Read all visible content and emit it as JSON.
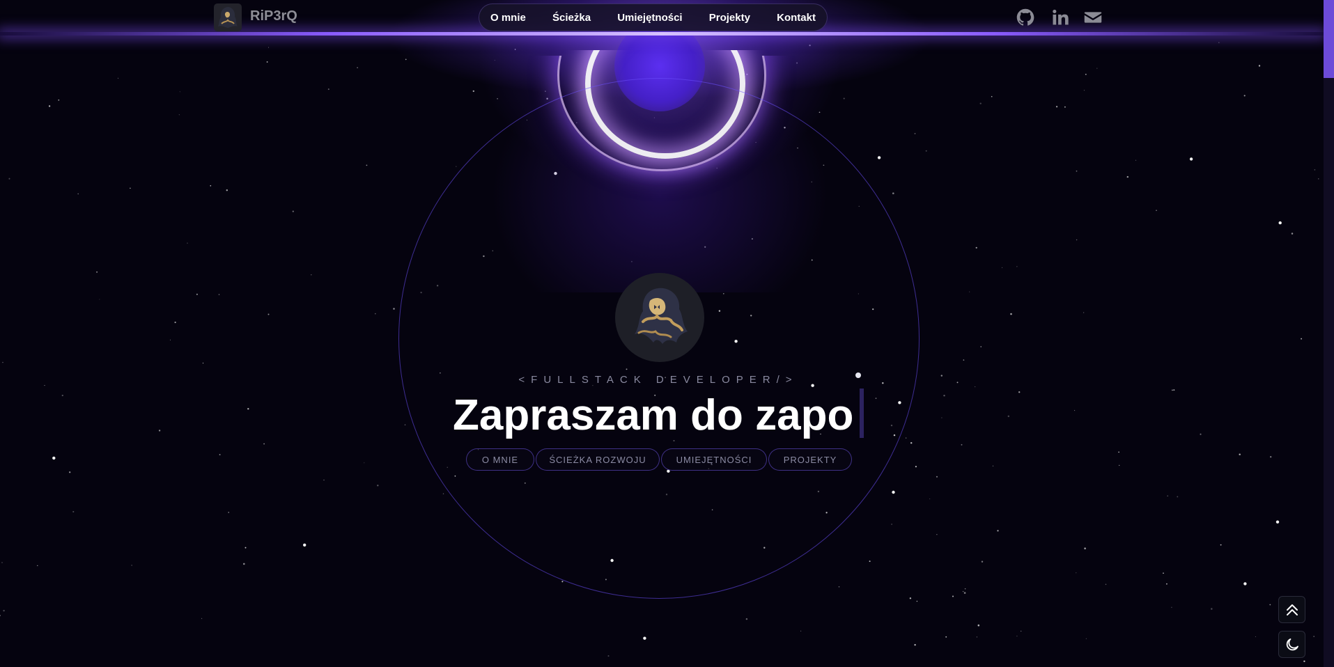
{
  "header": {
    "brand": "RiP3rQ",
    "nav": [
      "O mnie",
      "Ścieżka",
      "Umiejętności",
      "Projekty",
      "Kontakt"
    ],
    "social_icons": [
      "github-icon",
      "linkedin-icon",
      "mail-icon"
    ]
  },
  "hero": {
    "role": "<FULLSTACK DEVELOPER/>",
    "headline": "Zapraszam do zapo",
    "pills": [
      "O MNIE",
      "ŚCIEŻKA ROZWOJU",
      "UMIEJĘTNOŚCI",
      "PROJEKTY"
    ]
  },
  "floating": {
    "icons": [
      "double-chevron-up-icon",
      "moon-icon"
    ]
  },
  "colors": {
    "background": "#05030f",
    "accent": "#7b4dff",
    "glow": "#d6c2ff"
  }
}
